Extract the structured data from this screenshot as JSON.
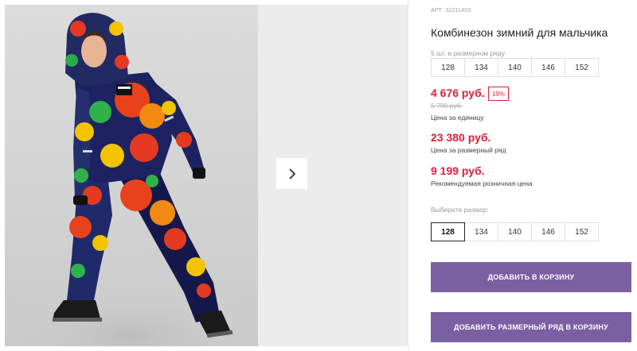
{
  "product": {
    "sku_label": "АРТ: 32211403",
    "title": "Комбинезон зимний для мальчика"
  },
  "size_run": {
    "label": "5 шт. в размерном ряду",
    "sizes": [
      "128",
      "134",
      "140",
      "146",
      "152"
    ]
  },
  "pricing": {
    "current": "4 676 руб.",
    "discount_badge": "19%",
    "old": "5 790 руб.",
    "unit_label": "Цена за единицу",
    "run_price": "23 380 руб.",
    "run_price_label": "Цена за размерный ряд",
    "rrp": "9 199 руб.",
    "rrp_label": "Рекомендуемая розничная цена"
  },
  "size_picker": {
    "label": "Выберите размер:",
    "sizes": [
      "128",
      "134",
      "140",
      "146",
      "152"
    ],
    "selected": "128"
  },
  "actions": {
    "add_to_cart": "ДОБАВИТЬ В КОРЗИНУ",
    "add_run_to_cart": "ДОБАВИТЬ РАЗМЕРНЫЙ РЯД В КОРЗИНУ"
  },
  "gallery": {
    "next_icon": "chevron-right-icon"
  },
  "colors": {
    "price_red": "#e01e3c",
    "button_purple": "#7b5fa3"
  }
}
